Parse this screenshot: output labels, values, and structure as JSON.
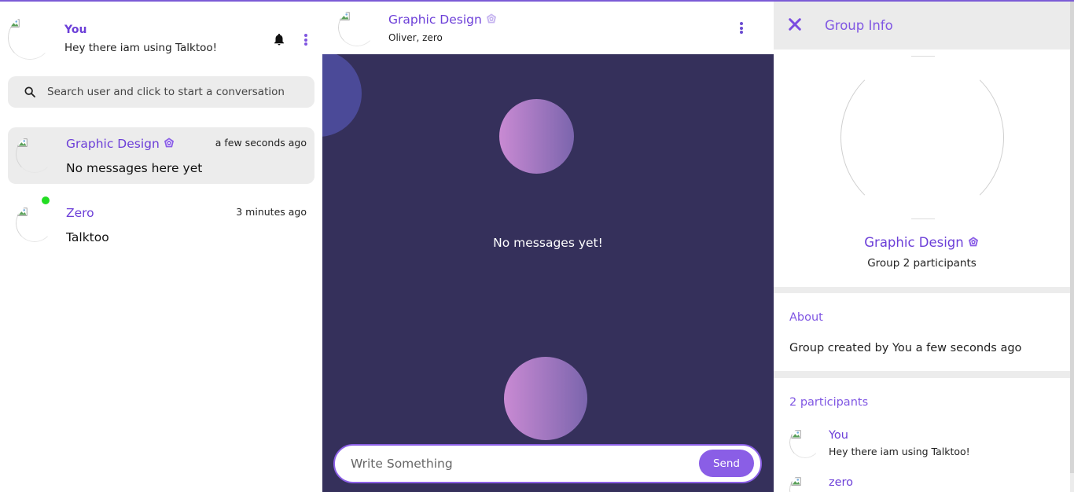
{
  "colors": {
    "accent": "#6c3fd8",
    "accent_light": "#8a5ee6",
    "chat_bg": "#35305b",
    "online": "#22dd22",
    "panel_gray": "#ececec"
  },
  "me": {
    "name": "You",
    "status": "Hey there iam using Talktoo!",
    "icons": [
      "bell-icon",
      "kebab-menu-icon"
    ]
  },
  "search": {
    "placeholder": "Search user and click to start a conversation",
    "icon": "search-icon"
  },
  "conversations": [
    {
      "name": "Graphic Design",
      "is_group": true,
      "time": "a few seconds ago",
      "last_message": "No messages here yet",
      "active": true,
      "online": false
    },
    {
      "name": "Zero",
      "is_group": false,
      "time": "3 minutes ago",
      "last_message": "Talktoo",
      "active": false,
      "online": true
    }
  ],
  "chat": {
    "title": "Graphic Design",
    "members": "Oliver, zero",
    "empty_text": "No messages yet!",
    "input_placeholder": "Write Something",
    "send_label": "Send"
  },
  "group_info": {
    "header_title": "Group Info",
    "name": "Graphic Design",
    "subtitle": "Group 2 participants",
    "about_title": "About",
    "about_text": "Group created by You a few seconds ago",
    "participants_title": "2 participants",
    "participants": [
      {
        "name": "You",
        "status": "Hey there iam using Talktoo!"
      },
      {
        "name": "zero",
        "status": ""
      }
    ]
  }
}
